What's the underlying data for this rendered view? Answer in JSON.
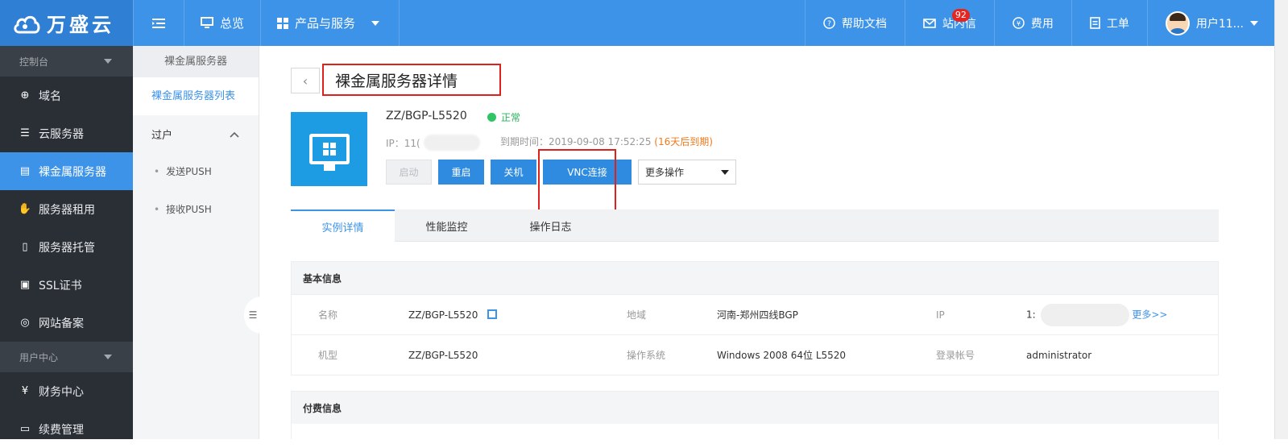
{
  "brand": {
    "name": "万盛云"
  },
  "topnav": {
    "overview": "总览",
    "products": "产品与服务",
    "help": "帮助文档",
    "messages": "站内信",
    "message_count": "92",
    "billing": "费用",
    "tickets": "工单",
    "user": "用户11..."
  },
  "sidebar": {
    "group1": "控制台",
    "items": [
      {
        "label": "域名",
        "icon": "globe-icon"
      },
      {
        "label": "云服务器",
        "icon": "server-icon"
      },
      {
        "label": "裸金属服务器",
        "icon": "list-icon"
      },
      {
        "label": "服务器租用",
        "icon": "hand-icon"
      },
      {
        "label": "服务器托管",
        "icon": "rack-icon"
      },
      {
        "label": "SSL证书",
        "icon": "cert-icon"
      },
      {
        "label": "网站备案",
        "icon": "record-icon"
      }
    ],
    "group2": "用户中心",
    "items2": [
      {
        "label": "财务中心",
        "icon": "yen-icon"
      },
      {
        "label": "续费管理",
        "icon": "renew-icon"
      }
    ]
  },
  "subnav": {
    "title": "裸金属服务器",
    "list_link": "裸金属服务器列表",
    "section": "过户",
    "sub1": "发送PUSH",
    "sub2": "接收PUSH"
  },
  "detail": {
    "page_title": "裸金属服务器详情",
    "server_name": "ZZ/BGP-L5520",
    "status": "正常",
    "ip_prefix": "IP：11(",
    "expiry_label": "到期时间：2019-09-08 17:52:25",
    "expiry_warn": "(16天后到期)",
    "buttons": {
      "start": "启动",
      "restart": "重启",
      "shutdown": "关机",
      "vnc": "VNC连接",
      "more_ops": "更多操作"
    }
  },
  "tabs": [
    "实例详情",
    "性能监控",
    "操作日志"
  ],
  "basic_info": {
    "title": "基本信息",
    "row1": {
      "name_label": "名称",
      "name_value": "ZZ/BGP-L5520",
      "region_label": "地域",
      "region_value": "河南-郑州四线BGP",
      "ip_label": "IP",
      "ip_value": "1:",
      "more": "更多>>"
    },
    "row2": {
      "model_label": "机型",
      "model_value": "ZZ/BGP-L5520",
      "os_label": "操作系统",
      "os_value": "Windows 2008 64位 L5520",
      "login_label": "登录帐号",
      "login_value": "administrator"
    }
  },
  "payment_info": {
    "title": "付费信息"
  },
  "colors": {
    "primary": "#3d93e8",
    "sidebar": "#2a2f35",
    "highlight": "#e0201a",
    "status_ok": "#2fc565",
    "warn": "#f07a1a"
  }
}
